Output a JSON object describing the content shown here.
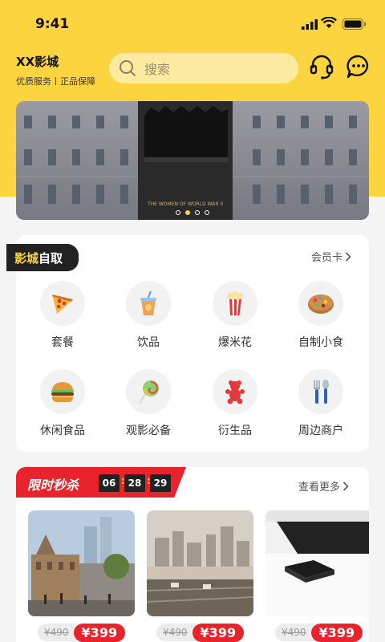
{
  "status": {
    "time": "9:41"
  },
  "header": {
    "brand_name": "XX影城",
    "brand_sub": "优质服务丨正品保障",
    "search_placeholder": "搜索"
  },
  "banner": {
    "caption": "THE WOMEN OF WORLD WAR II",
    "dot_count": 4,
    "active_dot": 1
  },
  "take_section": {
    "tag_white": "影城",
    "tag_yellow": "自取",
    "more": "会员卡",
    "items": [
      {
        "label": "套餐",
        "icon": "pizza-icon"
      },
      {
        "label": "饮品",
        "icon": "drink-icon"
      },
      {
        "label": "爆米花",
        "icon": "popcorn-icon"
      },
      {
        "label": "自制小食",
        "icon": "cookie-icon"
      },
      {
        "label": "休闲食品",
        "icon": "burger-icon"
      },
      {
        "label": "观影必备",
        "icon": "lollipop-icon"
      },
      {
        "label": "衍生品",
        "icon": "gummy-bear-icon"
      },
      {
        "label": "周边商户",
        "icon": "cutlery-icon"
      }
    ]
  },
  "flash_sale": {
    "title": "限时秒杀",
    "timer": {
      "h": "06",
      "m": "28",
      "s": "29"
    },
    "more": "查看更多",
    "products": [
      {
        "old_price": "¥490",
        "new_price": "¥399"
      },
      {
        "old_price": "¥490",
        "new_price": "¥399"
      },
      {
        "old_price": "¥490",
        "new_price": "¥399"
      }
    ]
  },
  "colors": {
    "brand_yellow": "#fcd440",
    "sale_red": "#e8232b"
  }
}
